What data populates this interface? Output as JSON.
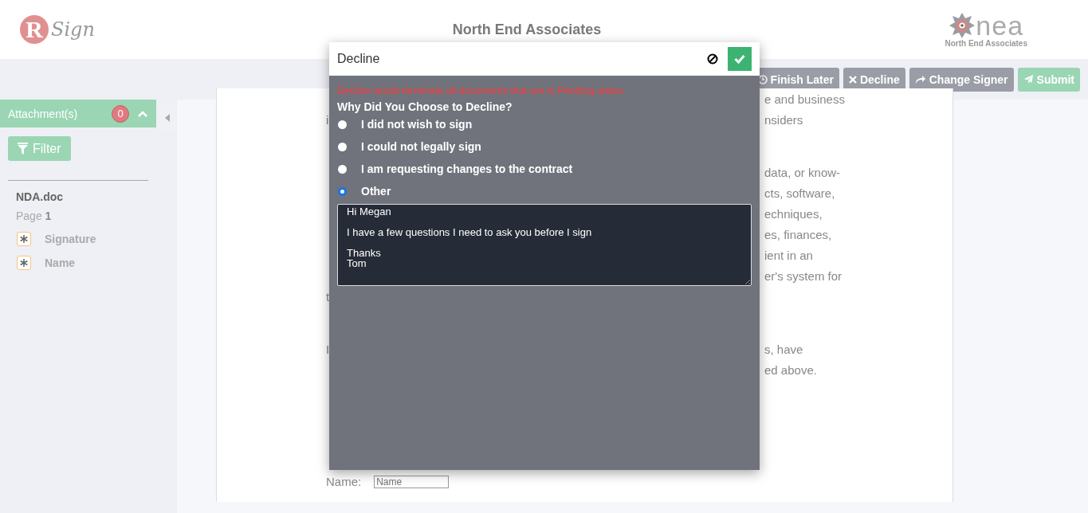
{
  "header": {
    "logo_text": "Sign",
    "logo_letter": "R",
    "title": "North End Associates",
    "company_logo": {
      "name": "nea",
      "tagline": "North End Associates"
    }
  },
  "toolbar": {
    "buttons": [
      {
        "label": "Finish Later",
        "kind": "clock",
        "disabled": false
      },
      {
        "label": "Decline",
        "kind": "cross",
        "disabled": false
      },
      {
        "label": "Change Signer",
        "kind": "share",
        "disabled": false
      },
      {
        "label": "Submit",
        "kind": "send",
        "disabled": true
      }
    ]
  },
  "sidebar": {
    "attachments": {
      "label": "Attachment(s)",
      "count": "0",
      "expanded": true
    },
    "filter": "Filter",
    "document": "NDA.doc",
    "page_label": "Page",
    "page_number": "1",
    "fields": [
      {
        "label": "Signature",
        "required": true
      },
      {
        "label": "Name",
        "required": true
      }
    ]
  },
  "document": {
    "lines": [
      {
        "right": "e and business"
      },
      {
        "left": "i",
        "right": "nsiders"
      },
      {
        "right": "data, or know-",
        "paragraph_start": true
      },
      {
        "right": "cts, software,"
      },
      {
        "right": "echniques,"
      },
      {
        "right": "es, finances,"
      },
      {
        "right": "ient in an"
      },
      {
        "right": "er's system for"
      },
      {
        "left": "t"
      },
      {
        "left": "I",
        "right": "s, have",
        "paragraph_start": true
      },
      {
        "right": "ed above."
      }
    ],
    "name_label": "Name:",
    "name_placeholder": "Name"
  },
  "dialog": {
    "title": "Decline",
    "warning": "Decline would terminate all documents that are in Pending status",
    "question": "Why Did You Choose to Decline?",
    "options": [
      {
        "label": "I did not wish to sign",
        "selected": false
      },
      {
        "label": "I could not legally sign",
        "selected": false
      },
      {
        "label": "I am requesting changes to the contract",
        "selected": false
      },
      {
        "label": "Other",
        "selected": true
      }
    ],
    "comment": "Hi Megan\n\nI have a few questions I need to ask you before I sign\n\nThanks\nTom"
  }
}
